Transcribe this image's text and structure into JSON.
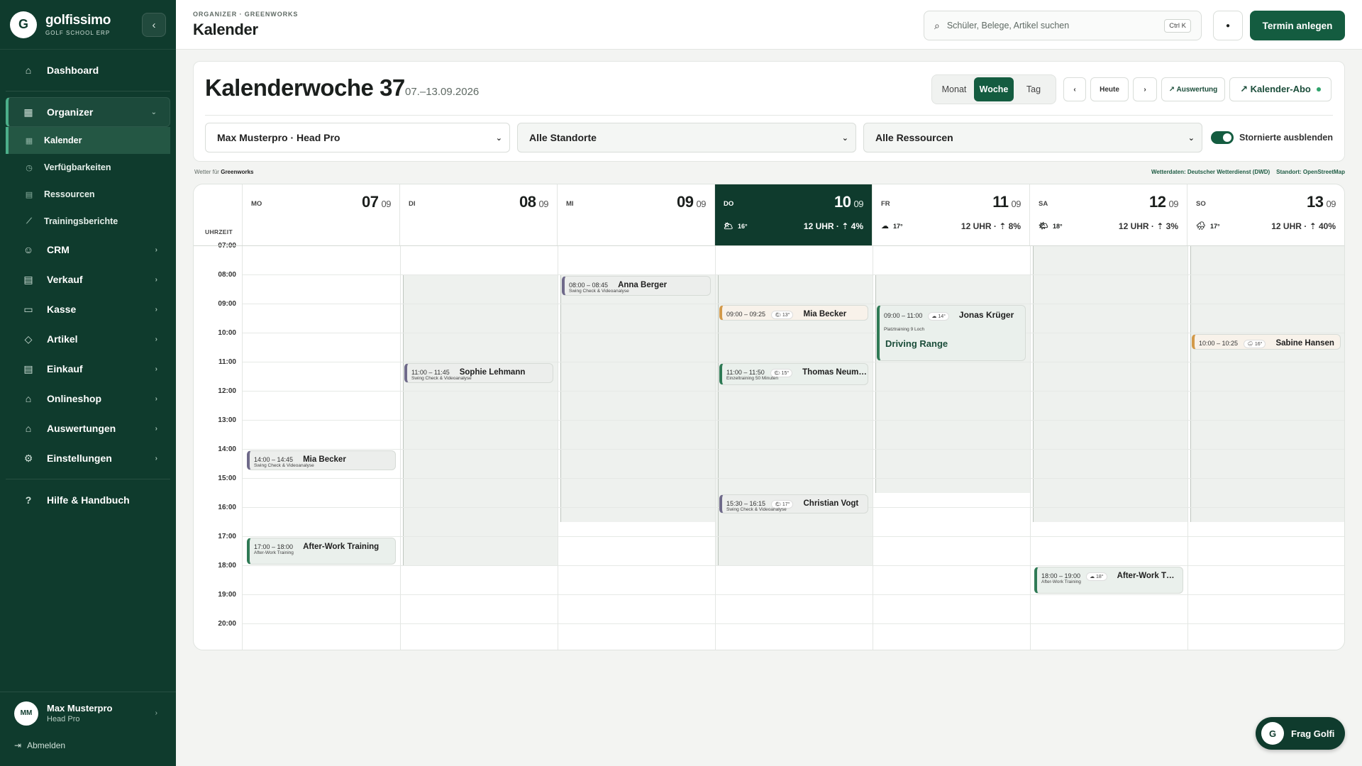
{
  "brand": {
    "name": "golfissimo",
    "sub": "GOLF SCHOOL ERP",
    "logo": "G"
  },
  "nav": {
    "dashboard": "Dashboard",
    "organizer": "Organizer",
    "organizer_sub": [
      "Kalender",
      "Verfügbarkeiten",
      "Ressourcen",
      "Trainingsberichte"
    ],
    "items": [
      "CRM",
      "Verkauf",
      "Kasse",
      "Artikel",
      "Einkauf",
      "Onlineshop",
      "Auswertungen",
      "Einstellungen"
    ],
    "help": "Hilfe & Handbuch"
  },
  "user": {
    "initials": "MM",
    "name": "Max Musterpro",
    "role": "Head Pro",
    "logout": "Abmelden"
  },
  "header": {
    "breadcrumb": "ORGANIZER · GREENWORKS",
    "title": "Kalender",
    "search_placeholder": "Schüler, Belege, Artikel suchen",
    "shortcut": "Ctrl K",
    "primary_button": "Termin anlegen"
  },
  "toolbar": {
    "week_title": "Kalenderwoche 37",
    "week_range": "07.–13.09.2026",
    "views": [
      "Monat",
      "Woche",
      "Tag"
    ],
    "active_view": "Woche",
    "prev": "‹",
    "today": "Heute",
    "next": "›",
    "report": "↗ Auswertung",
    "abo": "↗ Kalender-Abo"
  },
  "filters": {
    "pro": "Max Musterpro · Head Pro",
    "location": "Alle Standorte",
    "resource": "Alle Ressourcen",
    "toggle_label": "Stornierte ausblenden"
  },
  "weather_bar": {
    "left_prefix": "Wetter für",
    "left_place": "Greenworks",
    "right": "Wetterdaten: Deutscher Wetterdienst (DWD)    Standort: OpenStreetMap"
  },
  "calendar": {
    "time_header": "UHRZEIT",
    "hours": [
      "07:00",
      "08:00",
      "09:00",
      "10:00",
      "11:00",
      "12:00",
      "13:00",
      "14:00",
      "15:00",
      "16:00",
      "17:00",
      "18:00",
      "19:00",
      "20:00"
    ],
    "days": [
      {
        "name": "MO",
        "num": "07",
        "mon": "09"
      },
      {
        "name": "DI",
        "num": "08",
        "mon": "09"
      },
      {
        "name": "MI",
        "num": "09",
        "mon": "09"
      },
      {
        "name": "DO",
        "num": "10",
        "mon": "09",
        "today": true,
        "icon": "🌥",
        "temp": "16°",
        "noon": "12 UHR · ⇡ 4%"
      },
      {
        "name": "FR",
        "num": "11",
        "mon": "09",
        "icon": "☁",
        "temp": "17°",
        "noon": "12 UHR · ⇡ 8%"
      },
      {
        "name": "SA",
        "num": "12",
        "mon": "09",
        "icon": "🌤",
        "temp": "18°",
        "noon": "12 UHR · ⇡ 3%"
      },
      {
        "name": "SO",
        "num": "13",
        "mon": "09",
        "icon": "🌧",
        "temp": "17°",
        "noon": "12 UHR · ⇡ 40%"
      }
    ],
    "events": [
      {
        "day": 0,
        "start": 14.0,
        "end": 14.75,
        "time": "14:00 – 14:45",
        "name": "Mia Becker",
        "sub": "Swing Check & Videoanalyse",
        "style": "purple"
      },
      {
        "day": 0,
        "start": 17.0,
        "end": 18.0,
        "time": "17:00 – 18:00",
        "name": "After-Work Training",
        "sub": "After-Work Training",
        "style": "green"
      },
      {
        "day": 1,
        "start": 11.0,
        "end": 11.75,
        "time": "11:00 – 11:45",
        "name": "Sophie Lehmann",
        "sub": "Swing Check & Videoanalyse",
        "style": "purple"
      },
      {
        "day": 2,
        "start": 8.0,
        "end": 8.75,
        "time": "08:00 – 08:45",
        "name": "Anna Berger",
        "sub": "Swing Check & Videoanalyse",
        "style": "purple"
      },
      {
        "day": 3,
        "start": 9.0,
        "end": 9.42,
        "time": "09:00 – 09:25",
        "name": "Mia Becker",
        "wx": "🌤 13°",
        "style": "orange"
      },
      {
        "day": 3,
        "start": 11.0,
        "end": 11.83,
        "time": "11:00 – 11:50",
        "name": "Thomas Neum…",
        "wx": "🌤 15°",
        "sub": "Einzeltraining 50 Minuten",
        "style": "green"
      },
      {
        "day": 3,
        "start": 15.5,
        "end": 16.25,
        "time": "15:30 – 16:15",
        "name": "Christian Vogt",
        "wx": "🌤 17°",
        "sub": "Swing Check & Videoanalyse",
        "style": "purple"
      },
      {
        "day": 4,
        "start": 9.0,
        "end": 11.0,
        "time": "09:00 – 11:00",
        "name": "Jonas Krüger",
        "wx": "☁ 14°",
        "sub": "Platztraining 9 Loch",
        "loc": "Driving Range",
        "style": "green"
      },
      {
        "day": 5,
        "start": 18.0,
        "end": 19.0,
        "time": "18:00 – 19:00",
        "name": "After-Work T…",
        "wx": "☁ 18°",
        "sub": "After-Work Training",
        "style": "green"
      },
      {
        "day": 6,
        "start": 10.0,
        "end": 10.42,
        "time": "10:00 – 10:25",
        "name": "Sabine Hansen",
        "wx": "🌧 16°",
        "style": "orange"
      }
    ],
    "availability": [
      {
        "day": 1,
        "start": 8,
        "end": 18
      },
      {
        "day": 2,
        "start": 8,
        "end": 16.5
      },
      {
        "day": 3,
        "start": 8,
        "end": 18
      },
      {
        "day": 4,
        "start": 8,
        "end": 15.5
      },
      {
        "day": 5,
        "start": 7,
        "end": 16.5
      },
      {
        "day": 6,
        "start": 7,
        "end": 16.5
      }
    ]
  },
  "assistant": {
    "logo": "G",
    "label": "Frag Golfi"
  },
  "colors": {
    "primary": "#145c40",
    "sidebar": "#0f3b2d",
    "accent": "#4caf8a"
  }
}
